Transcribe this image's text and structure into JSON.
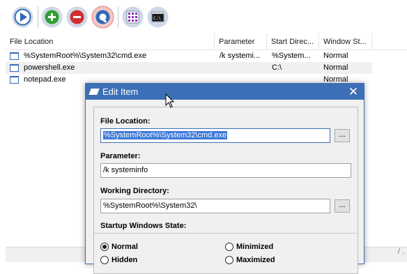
{
  "toolbar": {
    "buttons": [
      {
        "icon": "run-icon",
        "color": "#2f6ab8"
      },
      {
        "icon": "add-icon",
        "color": "#2fa02f"
      },
      {
        "icon": "remove-icon",
        "color": "#d03030"
      },
      {
        "icon": "edit-icon",
        "color": "#2f6ab8"
      },
      {
        "icon": "grid-icon",
        "color": "#8a2fb8"
      },
      {
        "icon": "console-icon",
        "color": "#2f6ab8"
      }
    ]
  },
  "list": {
    "columns": [
      "File Location",
      "Parameter",
      "Start Direc...",
      "Window St..."
    ],
    "rows": [
      {
        "file": "%SystemRoot%\\System32\\cmd.exe",
        "param": "/k systemi...",
        "dir": "%System...",
        "state": "Normal"
      },
      {
        "file": "powershell.exe",
        "param": "",
        "dir": "C:\\",
        "state": "Normal"
      },
      {
        "file": "notepad.exe",
        "param": "",
        "dir": "",
        "state": "Normal"
      }
    ],
    "status_text": "/ ."
  },
  "dialog": {
    "title": "Edit Item",
    "close_glyph": "✕",
    "file_location_label": "File Location:",
    "file_location_value": "%SystemRoot%\\System32\\cmd.exe",
    "parameter_label": "Parameter:",
    "parameter_value": "/k systeminfo",
    "working_dir_label": "Working Directory:",
    "working_dir_value": "%SystemRoot%\\System32\\",
    "browse_label": "...",
    "startup_label": "Startup Windows State:",
    "radios": {
      "normal": "Normal",
      "minimized": "Minimized",
      "hidden": "Hidden",
      "maximized": "Maximized"
    },
    "selected_state": "Normal"
  }
}
